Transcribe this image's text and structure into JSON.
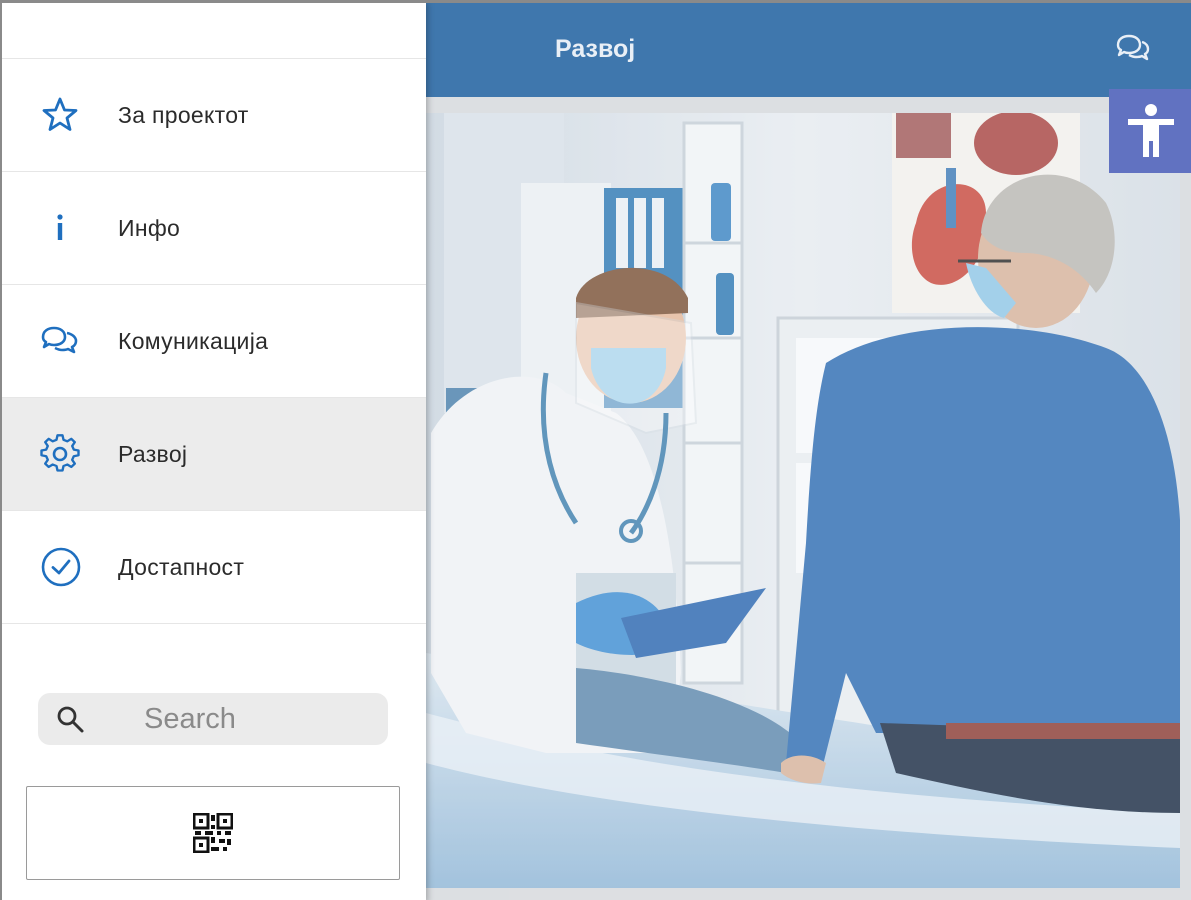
{
  "appbar": {
    "title": "Развој",
    "chat_icon": "chat-bubbles-icon",
    "color": "#155a9b"
  },
  "accessibility": {
    "icon": "accessibility-person-icon",
    "color": "#3f54b4"
  },
  "hero": {
    "icon": "photo-doctor-patient"
  },
  "drawer": {
    "items": [
      {
        "label": "За проектот",
        "icon": "star-icon",
        "active": false
      },
      {
        "label": "Инфо",
        "icon": "info-icon",
        "active": false
      },
      {
        "label": "Комуникација",
        "icon": "chat-bubbles-icon",
        "active": false
      },
      {
        "label": "Развој",
        "icon": "gear-icon",
        "active": true
      },
      {
        "label": "Достапност",
        "icon": "check-circle-icon",
        "active": false
      }
    ],
    "search": {
      "placeholder": "Search"
    },
    "qr_icon": "qr-code-icon",
    "accent": "#1f6fbf"
  }
}
